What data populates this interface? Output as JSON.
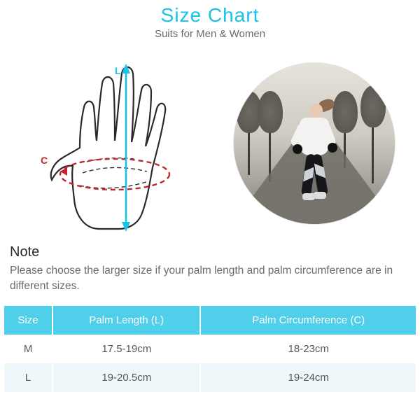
{
  "colors": {
    "accent": "#17c3e6",
    "header_bg": "#4fcfe9",
    "row_alt": "#eef8fb",
    "circumference": "#c1272d",
    "length_line": "#17c3e6"
  },
  "header": {
    "title": "Size Chart",
    "subtitle": "Suits for Men & Women"
  },
  "diagram": {
    "length_label": "L",
    "circumference_label": "C"
  },
  "note": {
    "heading": "Note",
    "text": "Please choose the larger size if your palm length and palm circumference are in different sizes."
  },
  "chart_data": {
    "type": "table",
    "columns": [
      "Size",
      "Palm Length (L)",
      "Palm Circumference (C)"
    ],
    "rows": [
      {
        "size": "M",
        "length": "17.5-19cm",
        "circumference": "18-23cm"
      },
      {
        "size": "L",
        "length": "19-20.5cm",
        "circumference": "19-24cm"
      }
    ]
  }
}
